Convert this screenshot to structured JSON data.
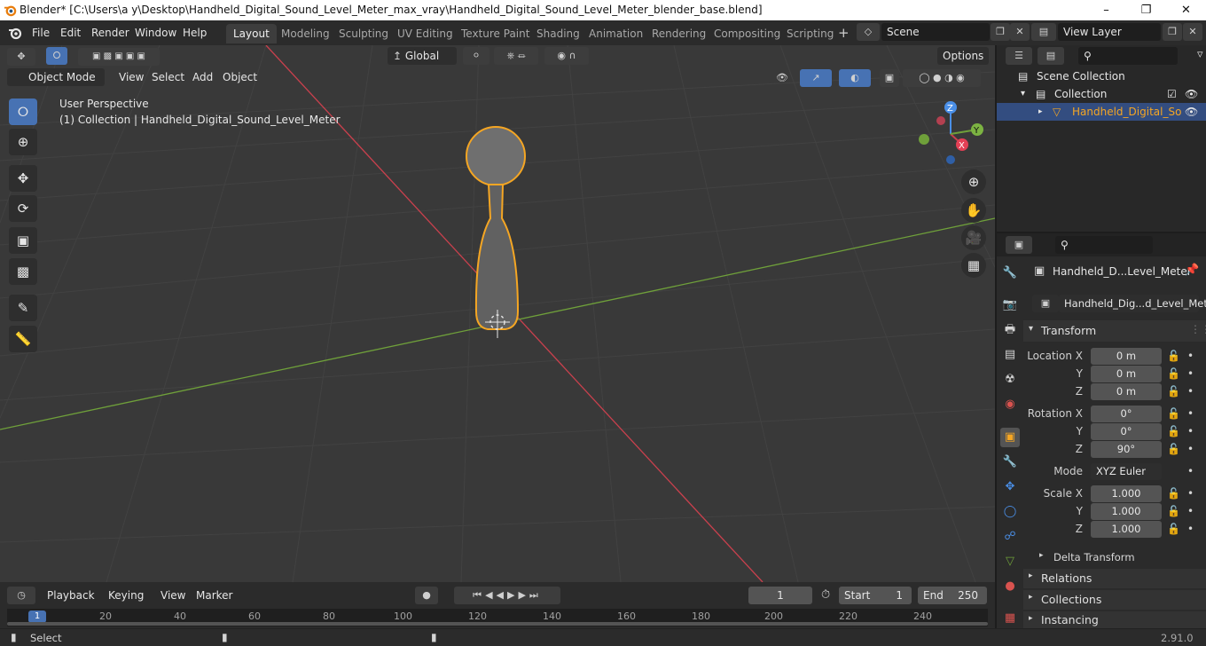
{
  "window": {
    "title": "Blender* [C:\\Users\\a y\\Desktop\\Handheld_Digital_Sound_Level_Meter_max_vray\\Handheld_Digital_Sound_Level_Meter_blender_base.blend]"
  },
  "menus": [
    "File",
    "Edit",
    "Render",
    "Window",
    "Help"
  ],
  "workspace_tabs": [
    {
      "label": "Layout",
      "active": true
    },
    {
      "label": "Modeling"
    },
    {
      "label": "Sculpting"
    },
    {
      "label": "UV Editing"
    },
    {
      "label": "Texture Paint"
    },
    {
      "label": "Shading"
    },
    {
      "label": "Animation"
    },
    {
      "label": "Rendering"
    },
    {
      "label": "Compositing"
    },
    {
      "label": "Scripting"
    }
  ],
  "scene": {
    "name": "Scene",
    "view_layer": "View Layer"
  },
  "viewport_header": {
    "transform_orientation": "Global",
    "options": "Options",
    "mode": "Object Mode",
    "menus": [
      "View",
      "Select",
      "Add",
      "Object"
    ]
  },
  "viewport": {
    "perspective": "User Perspective",
    "collection_info": "(1) Collection | Handheld_Digital_Sound_Level_Meter",
    "axes": {
      "x": "X",
      "y": "Y",
      "z": "Z"
    },
    "colors": {
      "x_axis": "#c9404d",
      "y_axis": "#6fa03a",
      "selection": "#f5a623",
      "bg": "#393939"
    }
  },
  "timeline": {
    "menus": [
      "Playback",
      "Keying",
      "View",
      "Marker"
    ],
    "current_frame": "1",
    "start_label": "Start",
    "start": "1",
    "end_label": "End",
    "end": "250",
    "ruler": [
      "1",
      "20",
      "40",
      "60",
      "80",
      "100",
      "120",
      "140",
      "160",
      "180",
      "200",
      "220",
      "240"
    ]
  },
  "status": {
    "select": "Select",
    "version": "2.91.0"
  },
  "outliner": {
    "scene_collection": "Scene Collection",
    "collection": "Collection",
    "object": "Handheld_Digital_So"
  },
  "properties": {
    "object_name": "Handheld_D...Level_Meter",
    "data_name": "Handheld_Dig...d_Level_Meter",
    "transform": "Transform",
    "location_label": "Location X",
    "loc_y": "Y",
    "loc_z": "Z",
    "location": [
      "0 m",
      "0 m",
      "0 m"
    ],
    "rotation_label": "Rotation X",
    "rot_y": "Y",
    "rot_z": "Z",
    "rotation": [
      "0°",
      "0°",
      "90°"
    ],
    "mode_label": "Mode",
    "mode": "XYZ Euler",
    "scale_label": "Scale X",
    "sc_y": "Y",
    "sc_z": "Z",
    "scale": [
      "1.000",
      "1.000",
      "1.000"
    ],
    "delta": "Delta Transform",
    "sections": [
      "Relations",
      "Collections",
      "Instancing"
    ]
  }
}
